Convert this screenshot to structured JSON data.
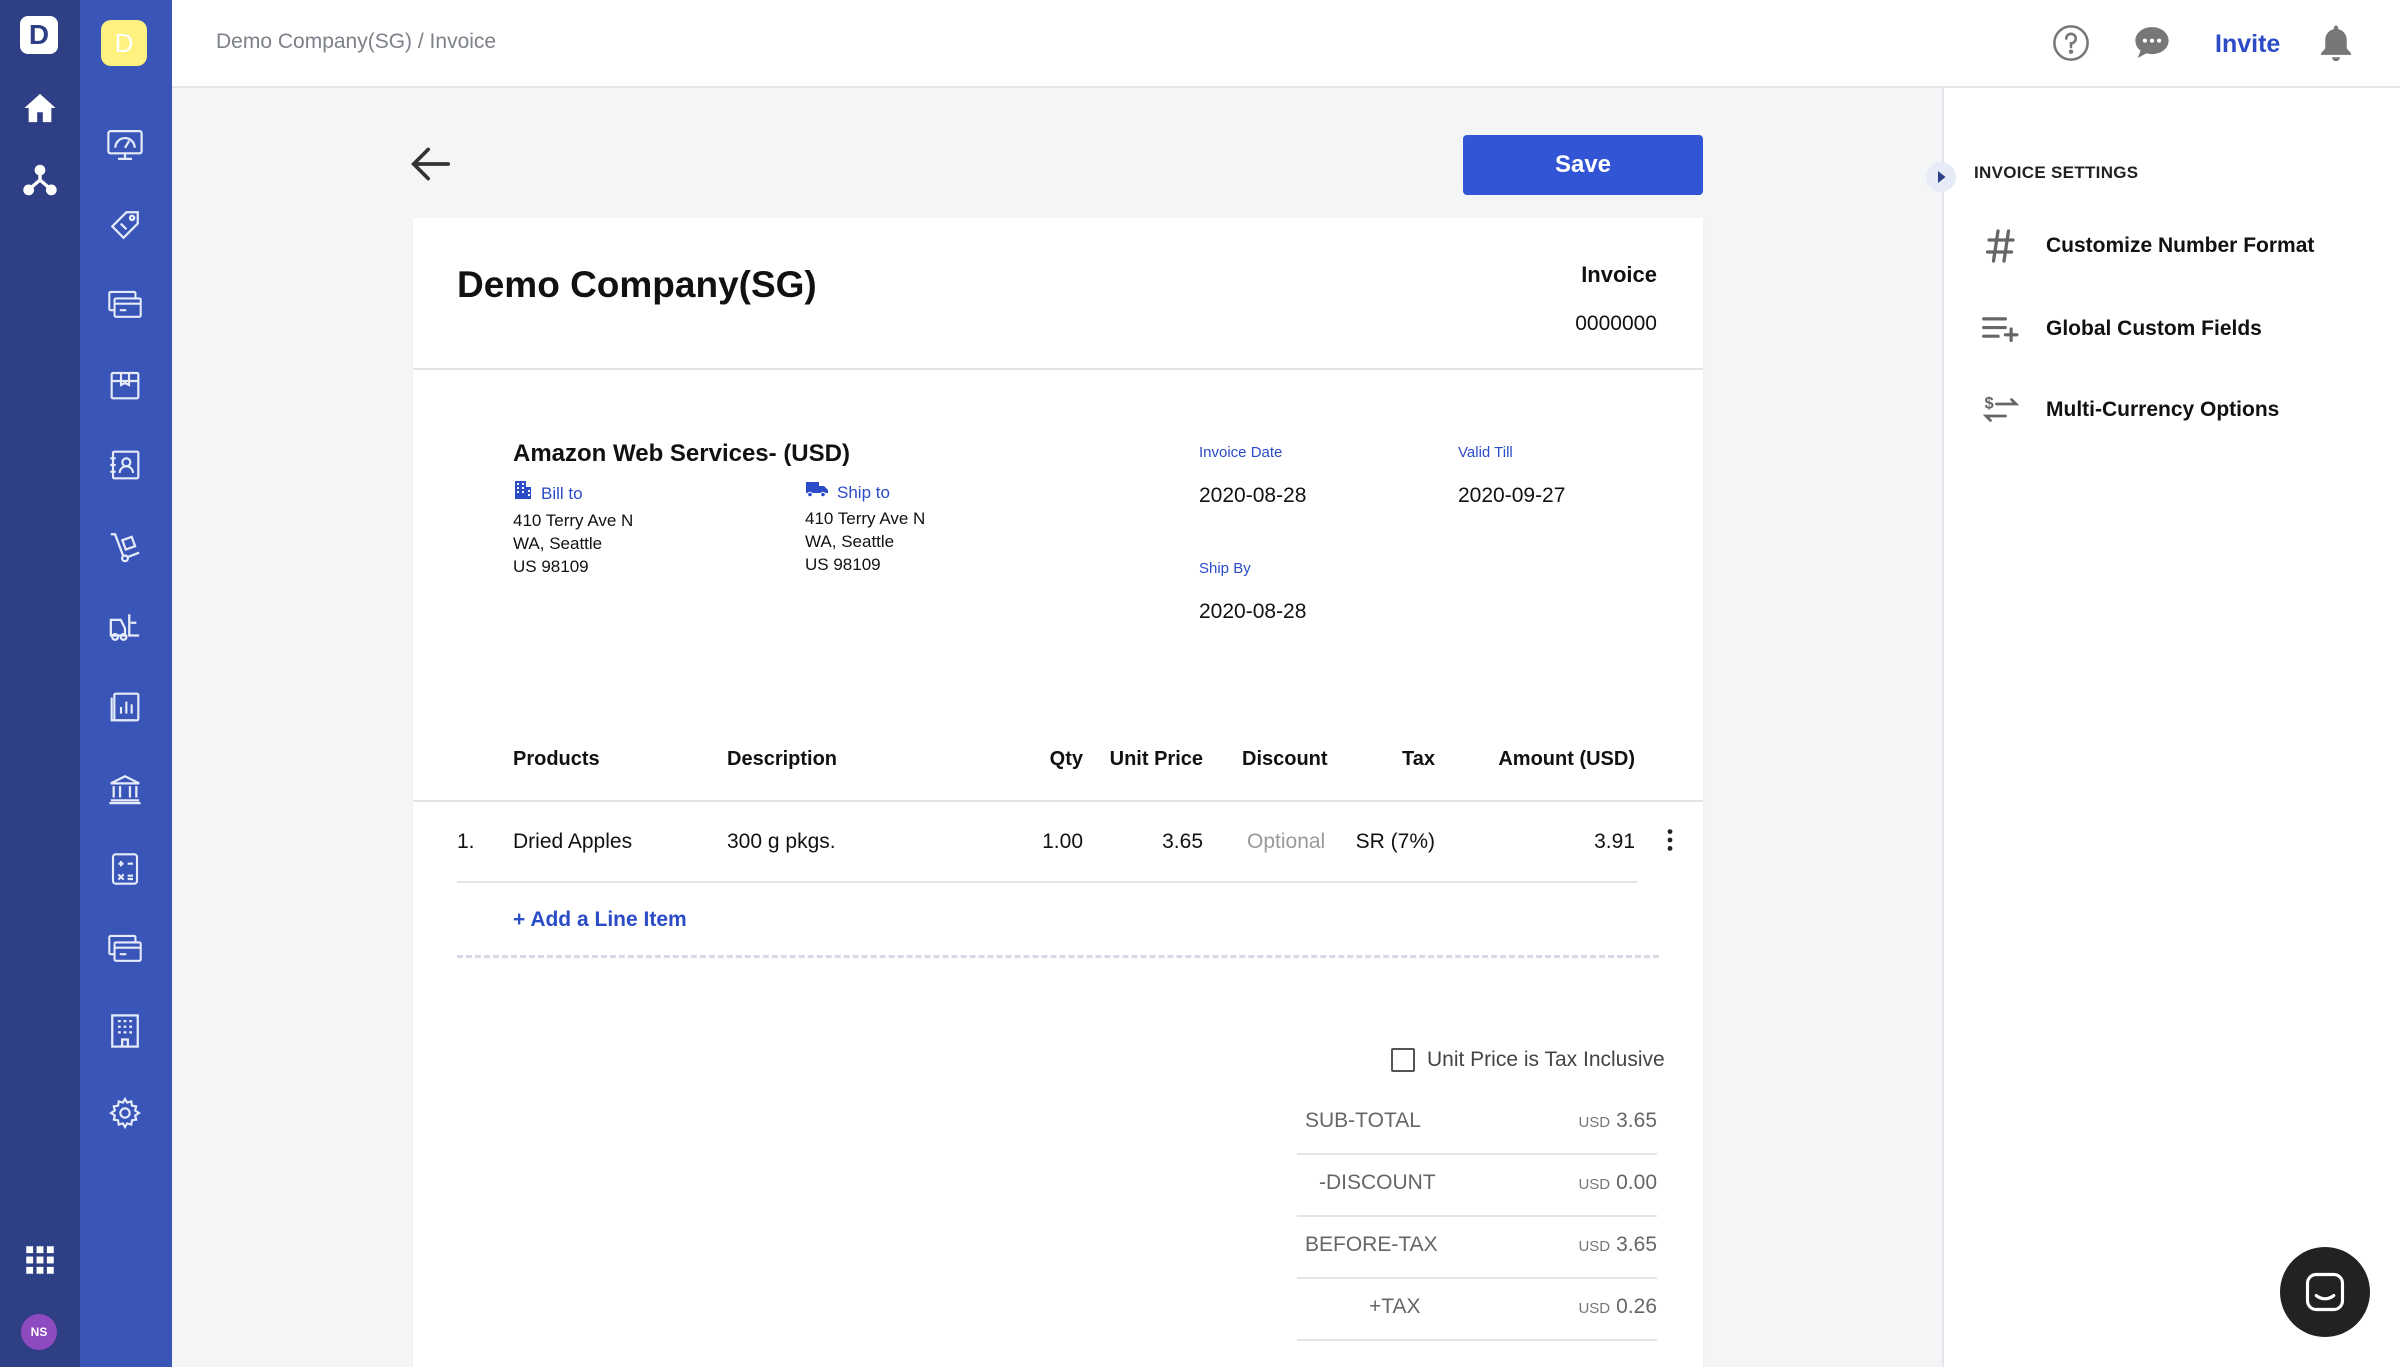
{
  "app": {
    "logo_letter": "D",
    "company_badge_letter": "D",
    "user_initials": "NS"
  },
  "header": {
    "breadcrumb": "Demo Company(SG) / Invoice",
    "invite_label": "Invite"
  },
  "toolbar": {
    "save_label": "Save"
  },
  "invoice": {
    "company_name": "Demo Company(SG)",
    "doc_label": "Invoice",
    "doc_number": "0000000",
    "customer": "Amazon Web Services- (USD)",
    "bill_to": {
      "title": "Bill to",
      "line1": "410 Terry Ave N",
      "line2": "WA, Seattle",
      "line3": "US 98109"
    },
    "ship_to": {
      "title": "Ship to",
      "line1": "410 Terry Ave N",
      "line2": "WA, Seattle",
      "line3": "US 98109"
    },
    "invoice_date": {
      "label": "Invoice Date",
      "value": "2020-08-28"
    },
    "valid_till": {
      "label": "Valid Till",
      "value": "2020-09-27"
    },
    "ship_by": {
      "label": "Ship By",
      "value": "2020-08-28"
    }
  },
  "table": {
    "headers": [
      "Products",
      "Description",
      "Qty",
      "Unit Price",
      "Discount",
      "Tax",
      "Amount (USD)"
    ],
    "rows": [
      {
        "index": "1.",
        "product": "Dried Apples",
        "description": "300 g pkgs.",
        "qty": "1.00",
        "unit_price": "3.65",
        "discount_placeholder": "Optional",
        "tax": "SR (7%)",
        "amount": "3.91"
      }
    ],
    "add_line_label": "+ Add a Line Item"
  },
  "totals": {
    "tax_inclusive_label": "Unit Price is Tax Inclusive",
    "currency": "USD",
    "rows": [
      {
        "label": "SUB-TOTAL",
        "value": "3.65"
      },
      {
        "label": "-DISCOUNT",
        "value": "0.00"
      },
      {
        "label": "BEFORE-TAX",
        "value": "3.65"
      },
      {
        "label": "+TAX",
        "value": "0.26"
      }
    ]
  },
  "settings_panel": {
    "title": "INVOICE SETTINGS",
    "items": [
      {
        "label": "Customize Number Format",
        "icon": "hash-icon"
      },
      {
        "label": "Global Custom Fields",
        "icon": "playlist-add-icon"
      },
      {
        "label": "Multi-Currency Options",
        "icon": "currency-exchange-icon"
      }
    ]
  },
  "colors": {
    "rail_dark": "#2e3f85",
    "rail_light": "#3955b8",
    "accent": "#3155d4",
    "link": "#2b4bc7"
  }
}
